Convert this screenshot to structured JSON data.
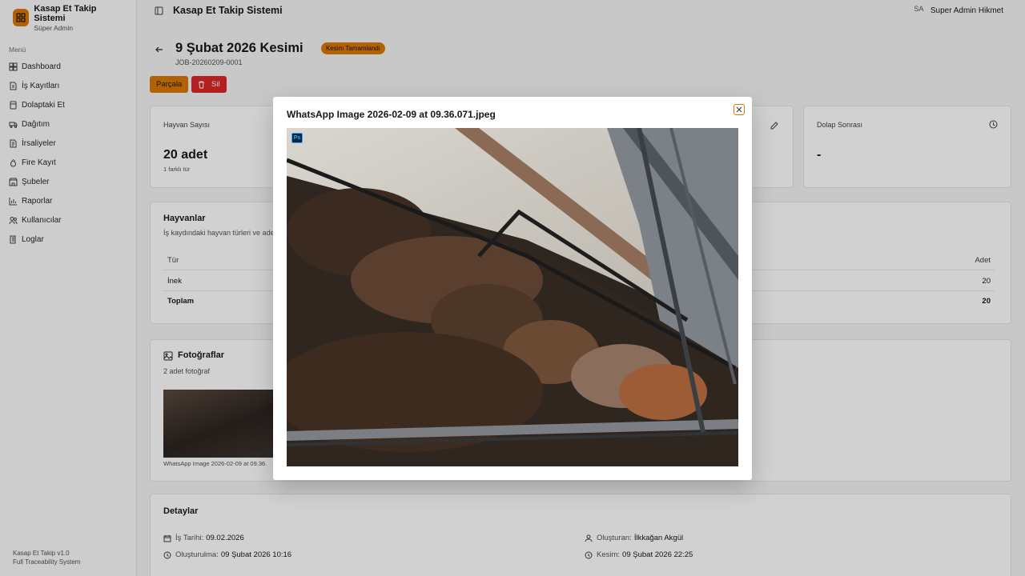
{
  "app": {
    "name": "Kasap Et Takip Sistemi",
    "role": "Süper Admin",
    "version": "Kasap Et Takip v1.0",
    "tagline": "Full Traceability System"
  },
  "sidebar": {
    "menu_label": "Menü",
    "items": [
      {
        "label": "Dashboard",
        "icon": "dashboard-icon"
      },
      {
        "label": "İş Kayıtları",
        "icon": "file-icon"
      },
      {
        "label": "Dolaptaki Et",
        "icon": "fridge-icon"
      },
      {
        "label": "Dağıtım",
        "icon": "truck-icon"
      },
      {
        "label": "İrsaliyeler",
        "icon": "document-icon"
      },
      {
        "label": "Fire Kayıt",
        "icon": "flame-icon"
      },
      {
        "label": "Şubeler",
        "icon": "store-icon"
      },
      {
        "label": "Raporlar",
        "icon": "chart-icon"
      },
      {
        "label": "Kullanıcılar",
        "icon": "users-icon"
      },
      {
        "label": "Loglar",
        "icon": "log-icon"
      }
    ]
  },
  "topbar": {
    "title": "Kasap Et Takip Sistemi",
    "user_initials": "SA",
    "user_name": "Super Admin Hikmet"
  },
  "page": {
    "title": "9 Şubat 2026 Kesimi",
    "status_badge": "Kesim Tamamlandı",
    "job_id": "JOB-20260209-0001",
    "actions": {
      "split": "Parçala",
      "delete": "Sil"
    }
  },
  "stats": {
    "animals": {
      "label": "Hayvan Sayısı",
      "value": "20 adet",
      "sub": "1 farklı tür"
    },
    "after_fridge": {
      "label": "Dolap Sonrası",
      "value": "-"
    }
  },
  "animals_section": {
    "title": "Hayvanlar",
    "desc": "İş kaydındaki hayvan türleri ve adetleri",
    "columns": [
      "Tür",
      "Adet"
    ],
    "rows": [
      {
        "type": "İnek",
        "count": "20"
      }
    ],
    "total": {
      "label": "Toplam",
      "count": "20"
    }
  },
  "photos_section": {
    "title": "Fotoğraflar",
    "desc": "2 adet fotoğraf",
    "thumb_caption": "WhatsApp Image 2026-02-09 at 09.36."
  },
  "details_section": {
    "title": "Detaylar",
    "job_date_label": "İş Tarihi:",
    "job_date": "09.02.2026",
    "created_label": "Oluşturulma:",
    "created": "09 Şubat 2026 10:16",
    "creator_label": "Oluşturan:",
    "creator": "İlkkağan Akgül",
    "slaughter_label": "Kesim:",
    "slaughter": "09 Şubat 2026 22:25"
  },
  "modal": {
    "title": "WhatsApp Image 2026-02-09 at 09.36.071.jpeg",
    "badge": "Ps",
    "close_icon": "close-icon"
  }
}
